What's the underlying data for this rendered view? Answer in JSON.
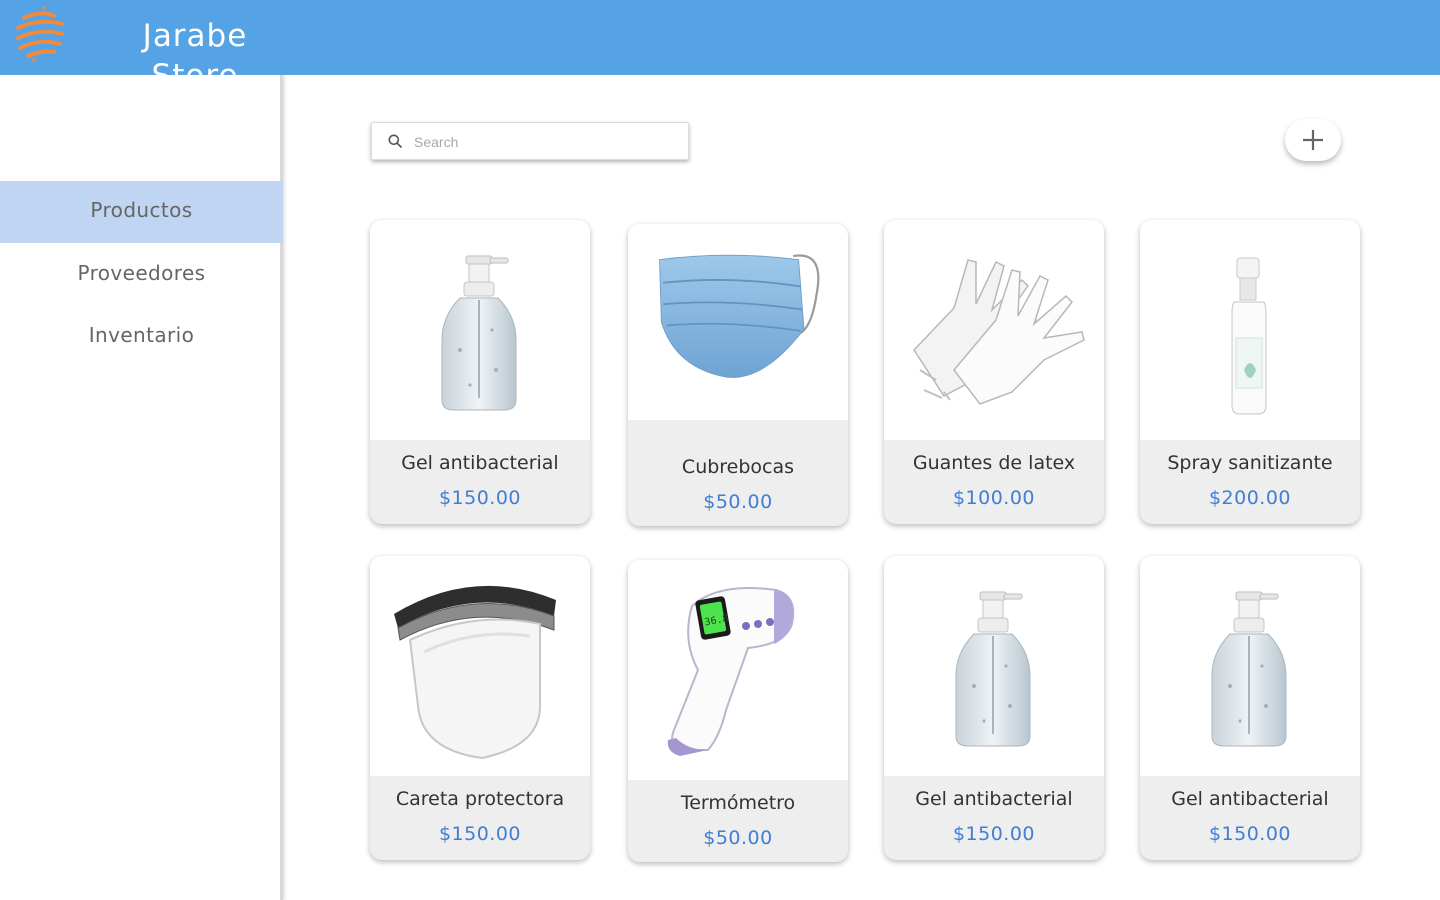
{
  "app": {
    "brand_line1": "Jarabe",
    "brand_line2": "Store",
    "accent_color": "#55a3e5",
    "logo_icon": "orange-sphere-logo"
  },
  "sidebar": {
    "items": [
      {
        "label": "Productos",
        "active": true
      },
      {
        "label": "Proveedores",
        "active": false
      },
      {
        "label": "Inventario",
        "active": false
      }
    ]
  },
  "search": {
    "placeholder": "Search",
    "value": "",
    "icon": "search-icon"
  },
  "add_button": {
    "icon": "plus-icon"
  },
  "products": [
    {
      "name": "Gel antibacterial",
      "price": "$150.00",
      "image": "gel-bottle"
    },
    {
      "name": "Cubrebocas",
      "price": "$50.00",
      "image": "face-mask"
    },
    {
      "name": "Guantes de latex",
      "price": "$100.00",
      "image": "latex-gloves"
    },
    {
      "name": "Spray sanitizante",
      "price": "$200.00",
      "image": "spray-bottle"
    },
    {
      "name": "Careta protectora",
      "price": "$150.00",
      "image": "face-shield"
    },
    {
      "name": "Termómetro",
      "price": "$50.00",
      "image": "thermometer"
    },
    {
      "name": "Gel antibacterial",
      "price": "$150.00",
      "image": "gel-bottle"
    },
    {
      "name": "Gel antibacterial",
      "price": "$150.00",
      "image": "gel-bottle"
    }
  ]
}
